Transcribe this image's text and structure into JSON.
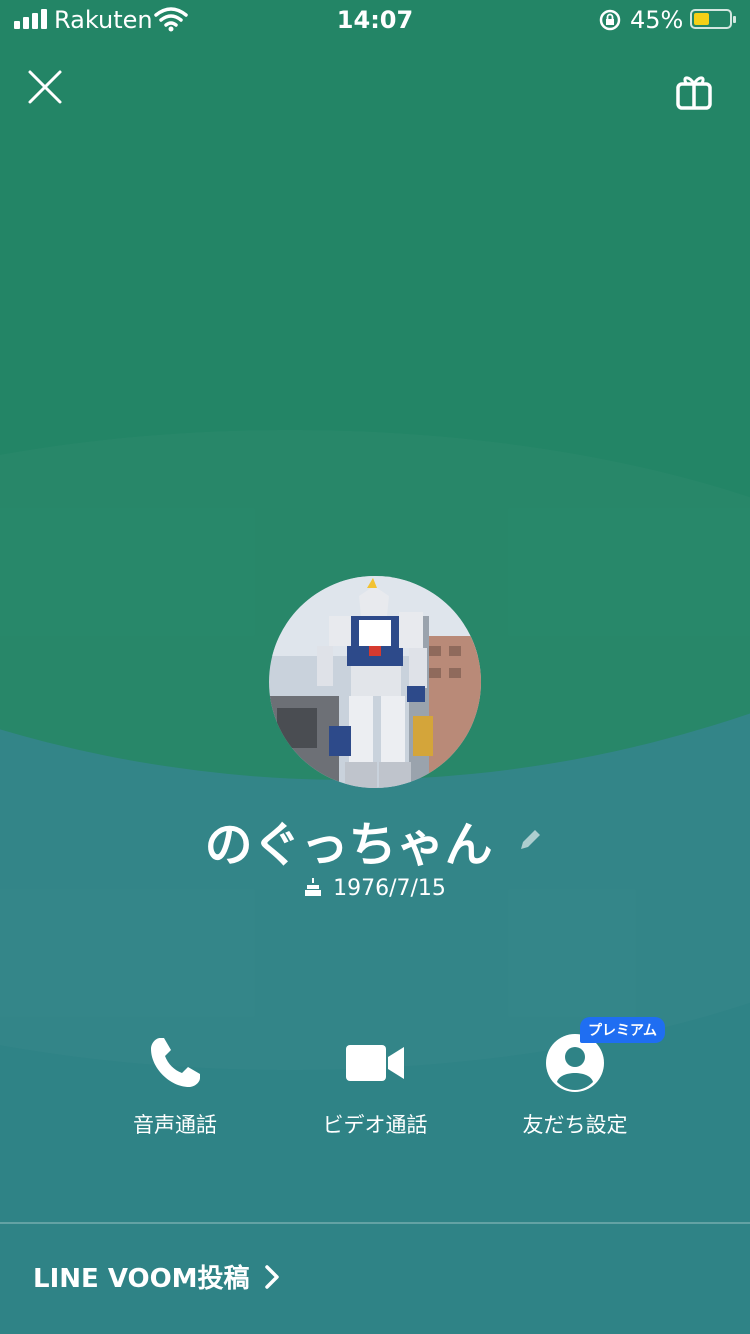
{
  "status_bar": {
    "carrier": "Rakuten",
    "time": "14:07",
    "battery_percent": "45%",
    "battery_level": 0.45,
    "battery_color": "#f5d017"
  },
  "header": {
    "close_icon": "close-icon",
    "gift_icon": "gift-icon"
  },
  "profile": {
    "name": "のぐっちゃん",
    "birthday": "1976/7/15"
  },
  "actions": [
    {
      "label": "音声通話",
      "icon": "phone-icon"
    },
    {
      "label": "ビデオ通話",
      "icon": "video-camera-icon"
    },
    {
      "label": "友だち設定",
      "icon": "person-icon",
      "badge": "プレミアム"
    }
  ],
  "footer": {
    "voom_label": "LINE VOOM投稿"
  },
  "colors": {
    "background_dark": "#238566",
    "background_teal": "#2f8386",
    "premium_badge": "#1f6ef2"
  }
}
